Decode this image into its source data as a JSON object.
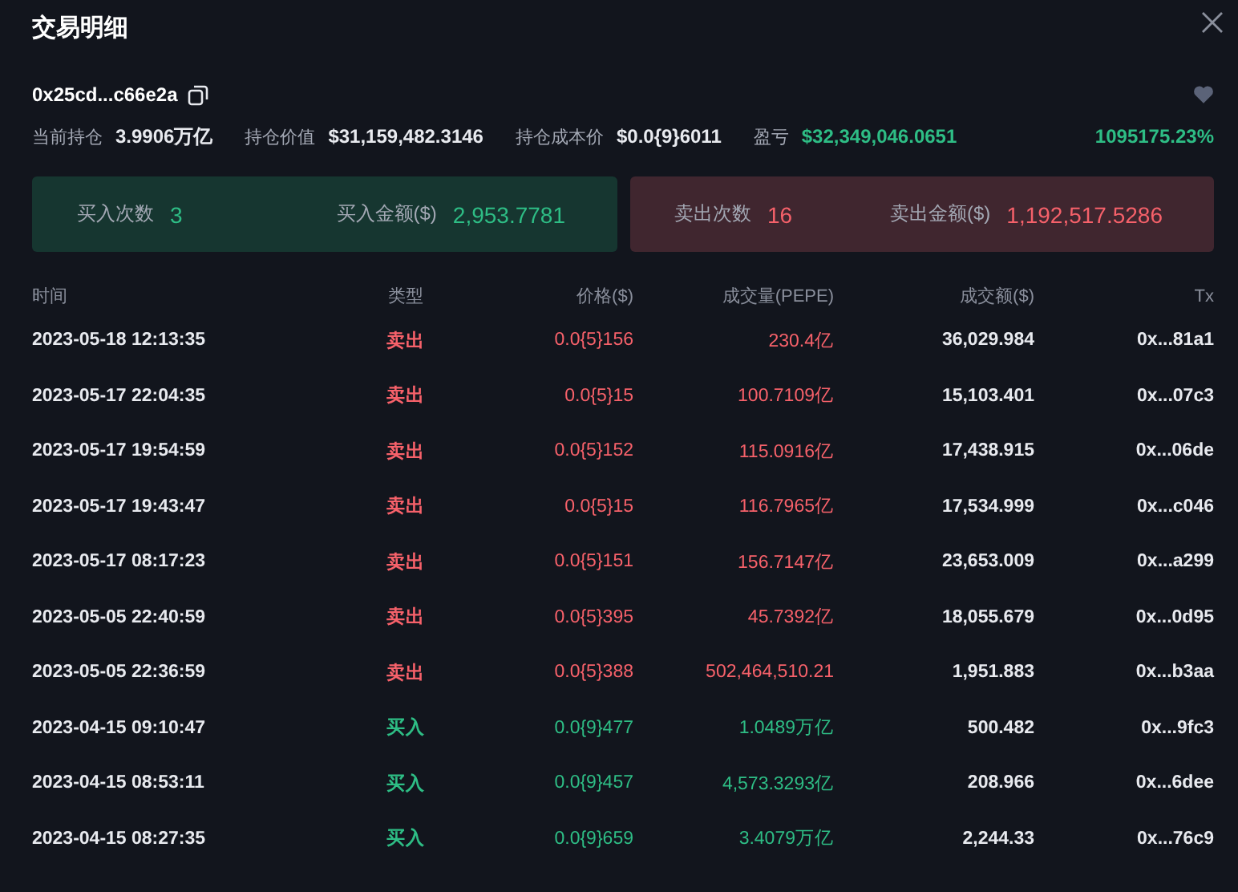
{
  "title": "交易明细",
  "wallet": {
    "address": "0x25cd...c66e2a",
    "favorite": false
  },
  "stats": [
    {
      "label": "当前持仓",
      "value": "3.9906万亿",
      "kind": "plain"
    },
    {
      "label": "持仓价值",
      "value": "$31,159,482.3146",
      "kind": "plain"
    },
    {
      "label": "持仓成本价",
      "value": "$0.0{9}6011",
      "kind": "plain"
    },
    {
      "label": "盈亏",
      "value": "$32,349,046.0651",
      "extra": "1095175.23%",
      "kind": "gain"
    }
  ],
  "summary": [
    {
      "kind": "buy",
      "count_label": "买入次数",
      "count": "3",
      "amount_label": "买入金额($)",
      "amount": "2,953.7781"
    },
    {
      "kind": "sell",
      "count_label": "卖出次数",
      "count": "16",
      "amount_label": "卖出金额($)",
      "amount": "1,192,517.5286"
    }
  ],
  "table": {
    "columns": [
      "时间",
      "类型",
      "价格($)",
      "成交量(PEPE)",
      "成交额($)",
      "Tx"
    ],
    "rows": [
      {
        "kind": "sell",
        "time": "2023-05-18 12:13:35",
        "type": "卖出",
        "price": "0.0{5}156",
        "volume": "230.4亿",
        "amount": "36,029.984",
        "tx": "0x...81a1"
      },
      {
        "kind": "sell",
        "time": "2023-05-17 22:04:35",
        "type": "卖出",
        "price": "0.0{5}15",
        "volume": "100.7109亿",
        "amount": "15,103.401",
        "tx": "0x...07c3"
      },
      {
        "kind": "sell",
        "time": "2023-05-17 19:54:59",
        "type": "卖出",
        "price": "0.0{5}152",
        "volume": "115.0916亿",
        "amount": "17,438.915",
        "tx": "0x...06de"
      },
      {
        "kind": "sell",
        "time": "2023-05-17 19:43:47",
        "type": "卖出",
        "price": "0.0{5}15",
        "volume": "116.7965亿",
        "amount": "17,534.999",
        "tx": "0x...c046"
      },
      {
        "kind": "sell",
        "time": "2023-05-17 08:17:23",
        "type": "卖出",
        "price": "0.0{5}151",
        "volume": "156.7147亿",
        "amount": "23,653.009",
        "tx": "0x...a299"
      },
      {
        "kind": "sell",
        "time": "2023-05-05 22:40:59",
        "type": "卖出",
        "price": "0.0{5}395",
        "volume": "45.7392亿",
        "amount": "18,055.679",
        "tx": "0x...0d95"
      },
      {
        "kind": "sell",
        "time": "2023-05-05 22:36:59",
        "type": "卖出",
        "price": "0.0{5}388",
        "volume": "502,464,510.21",
        "amount": "1,951.883",
        "tx": "0x...b3aa"
      },
      {
        "kind": "buy",
        "time": "2023-04-15 09:10:47",
        "type": "买入",
        "price": "0.0{9}477",
        "volume": "1.0489万亿",
        "amount": "500.482",
        "tx": "0x...9fc3"
      },
      {
        "kind": "buy",
        "time": "2023-04-15 08:53:11",
        "type": "买入",
        "price": "0.0{9}457",
        "volume": "4,573.3293亿",
        "amount": "208.966",
        "tx": "0x...6dee"
      },
      {
        "kind": "buy",
        "time": "2023-04-15 08:27:35",
        "type": "买入",
        "price": "0.0{9}659",
        "volume": "3.4079万亿",
        "amount": "2,244.33",
        "tx": "0x...76c9"
      }
    ]
  }
}
